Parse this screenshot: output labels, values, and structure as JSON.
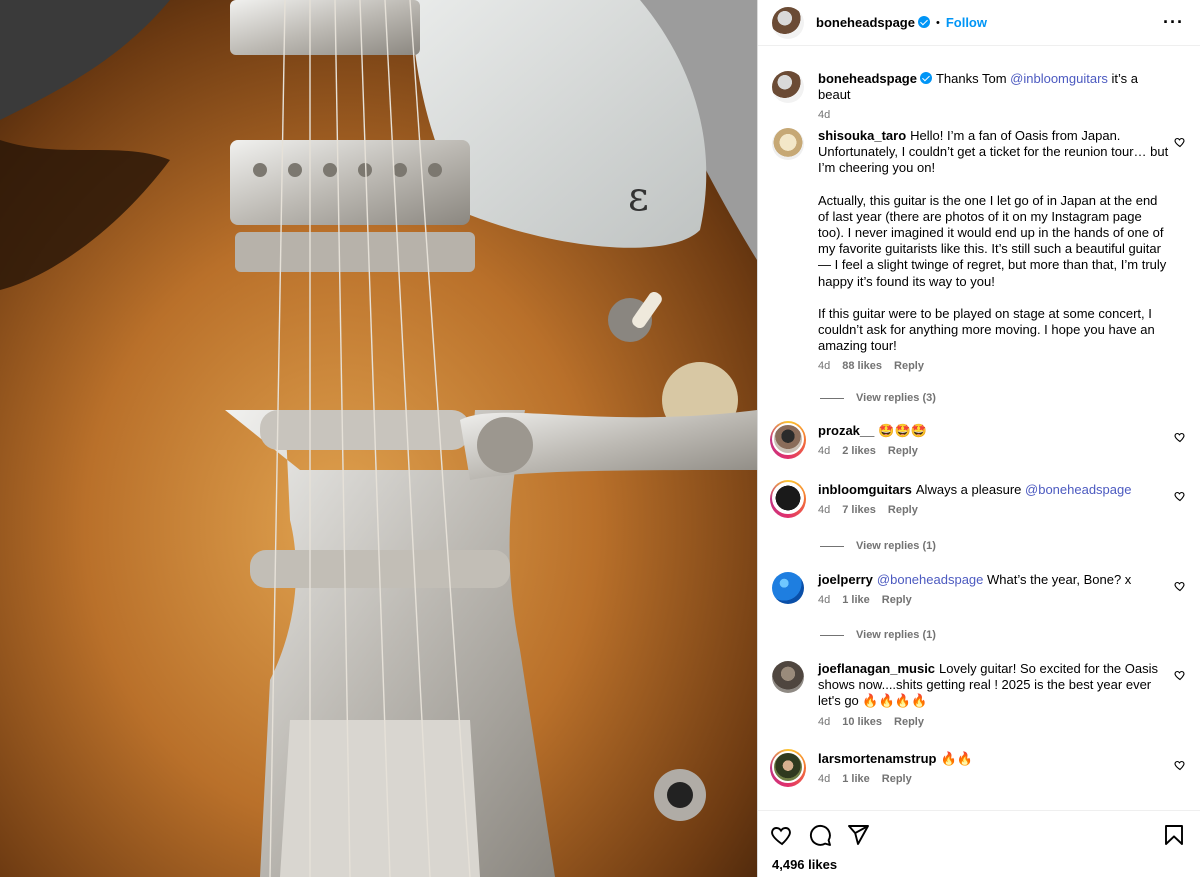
{
  "header": {
    "username": "boneheadspage",
    "separator": "•",
    "follow_label": "Follow",
    "more_label": "···"
  },
  "caption": {
    "username": "boneheadspage",
    "text_before": "Thanks Tom ",
    "mention": "@inbloomguitars",
    "text_after": " it’s a beaut",
    "time": "4d"
  },
  "comments": [
    {
      "username": "shisouka_taro",
      "paragraphs": [
        "Hello! I’m a fan of Oasis from Japan. Unfortunately, I couldn’t get a ticket for the reunion tour… but I’m cheering you on!",
        "Actually, this guitar is the one I let go of in Japan at the end of last year (there are photos of it on my Instagram page too). I never imagined it would end up in the hands of one of my favorite guitarists like this. It’s still such a beautiful guitar — I feel a slight twinge of regret, but more than that, I’m truly happy it’s found its way to you!",
        "If this guitar were to be played on stage at some concert, I couldn’t ask for anything more moving. I hope you have an amazing tour!"
      ],
      "time": "4d",
      "likes": "88 likes",
      "reply": "Reply",
      "view_replies": "View replies (3)"
    },
    {
      "username": "prozak__",
      "text": "🤩🤩🤩",
      "time": "4d",
      "likes": "2 likes",
      "reply": "Reply"
    },
    {
      "username": "inbloomguitars",
      "text_before": "Always a pleasure ",
      "mention": "@boneheadspage",
      "time": "4d",
      "likes": "7 likes",
      "reply": "Reply",
      "view_replies": "View replies (1)"
    },
    {
      "username": "joelperry",
      "mention": "@boneheadspage",
      "text_after": " What’s the year, Bone? x",
      "time": "4d",
      "likes": "1 like",
      "reply": "Reply",
      "view_replies": "View replies (1)"
    },
    {
      "username": "joeflanagan_music",
      "text": "Lovely guitar! So excited for the Oasis shows now....shits getting real ! 2025 is the best year ever let's go 🔥🔥🔥🔥",
      "time": "4d",
      "likes": "10 likes",
      "reply": "Reply"
    },
    {
      "username": "larsmortenamstrup",
      "text": "🔥🔥",
      "time": "4d",
      "likes": "1 like",
      "reply": "Reply"
    }
  ],
  "footer": {
    "likes": "4,496 likes"
  },
  "icons": {
    "like": "heart-icon",
    "comment": "comment-icon",
    "share": "share-icon",
    "save": "bookmark-icon"
  },
  "colors": {
    "accent": "#0095f6",
    "mention": "#4c5ac0",
    "muted": "#737373"
  }
}
